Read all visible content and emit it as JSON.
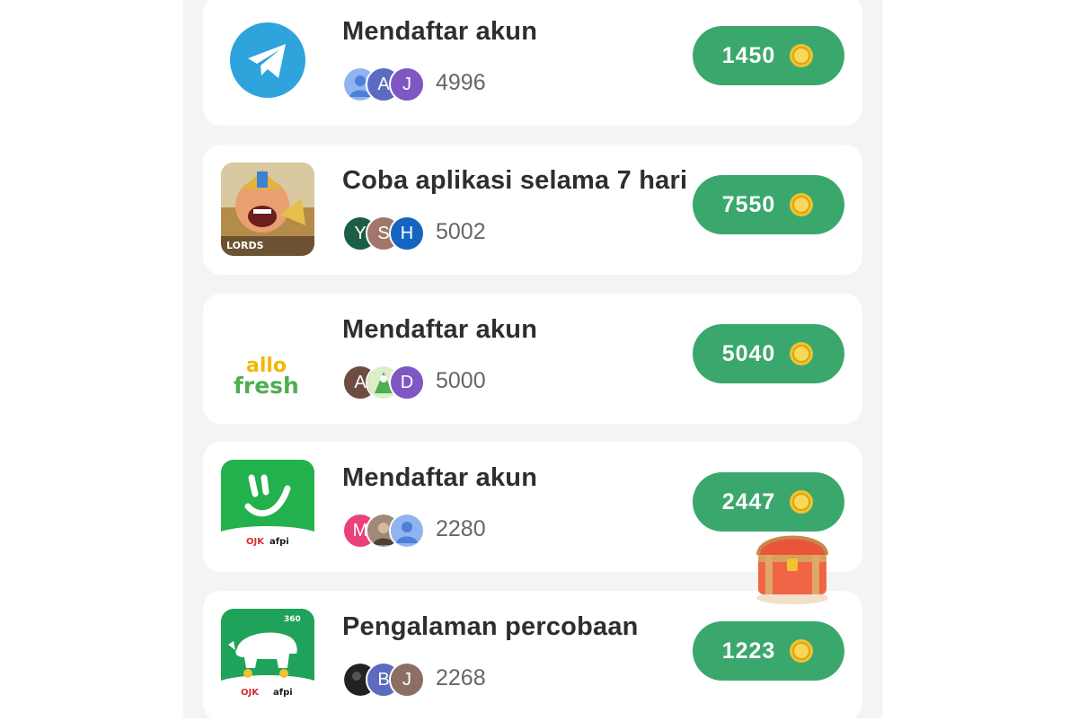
{
  "tasks": [
    {
      "app": "telegram",
      "title": "Mendaftar akun",
      "avatars": [
        {
          "letter": "",
          "color": "#8fb4f0",
          "kind": "person"
        },
        {
          "letter": "A",
          "color": "#5c6bc0",
          "kind": "letter"
        },
        {
          "letter": "J",
          "color": "#7e57c2",
          "kind": "letter"
        }
      ],
      "participants": "4996",
      "reward": "1450"
    },
    {
      "app": "lords-mobile",
      "title": "Coba aplikasi selama 7 hari",
      "avatars": [
        {
          "letter": "Y",
          "color": "#1b5e44",
          "kind": "letter"
        },
        {
          "letter": "S",
          "color": "#a1776b",
          "kind": "letter"
        },
        {
          "letter": "H",
          "color": "#1565c0",
          "kind": "letter"
        }
      ],
      "participants": "5002",
      "reward": "7550"
    },
    {
      "app": "allo-fresh",
      "title": "Mendaftar akun",
      "avatars": [
        {
          "letter": "A",
          "color": "#6d4c41",
          "kind": "letter"
        },
        {
          "letter": "",
          "color": "#c5e1a5",
          "kind": "photo"
        },
        {
          "letter": "D",
          "color": "#7e57c2",
          "kind": "letter"
        }
      ],
      "participants": "5000",
      "reward": "5040"
    },
    {
      "app": "smile-loan",
      "title": "Mendaftar akun",
      "avatars": [
        {
          "letter": "M",
          "color": "#ec407a",
          "kind": "letter"
        },
        {
          "letter": "",
          "color": "#8d7b6a",
          "kind": "photo"
        },
        {
          "letter": "",
          "color": "#8fb4f0",
          "kind": "person"
        }
      ],
      "participants": "2280",
      "reward": "2447"
    },
    {
      "app": "rhino-loan",
      "title": "Pengalaman percobaan",
      "avatars": [
        {
          "letter": "",
          "color": "#222222",
          "kind": "photo"
        },
        {
          "letter": "B",
          "color": "#5c6bc0",
          "kind": "letter"
        },
        {
          "letter": "J",
          "color": "#8d6e63",
          "kind": "letter"
        }
      ],
      "participants": "2268",
      "reward": "1223"
    }
  ],
  "icon_texts": {
    "allo": "allo",
    "fresh": "fresh",
    "ojk": "OJK",
    "afpi": "afpi",
    "lords": "LORDS",
    "brand_360": "360"
  },
  "colors": {
    "accent_green": "#3aa86c",
    "coin_gold": "#f2c230",
    "background": "#f4f4f4"
  }
}
